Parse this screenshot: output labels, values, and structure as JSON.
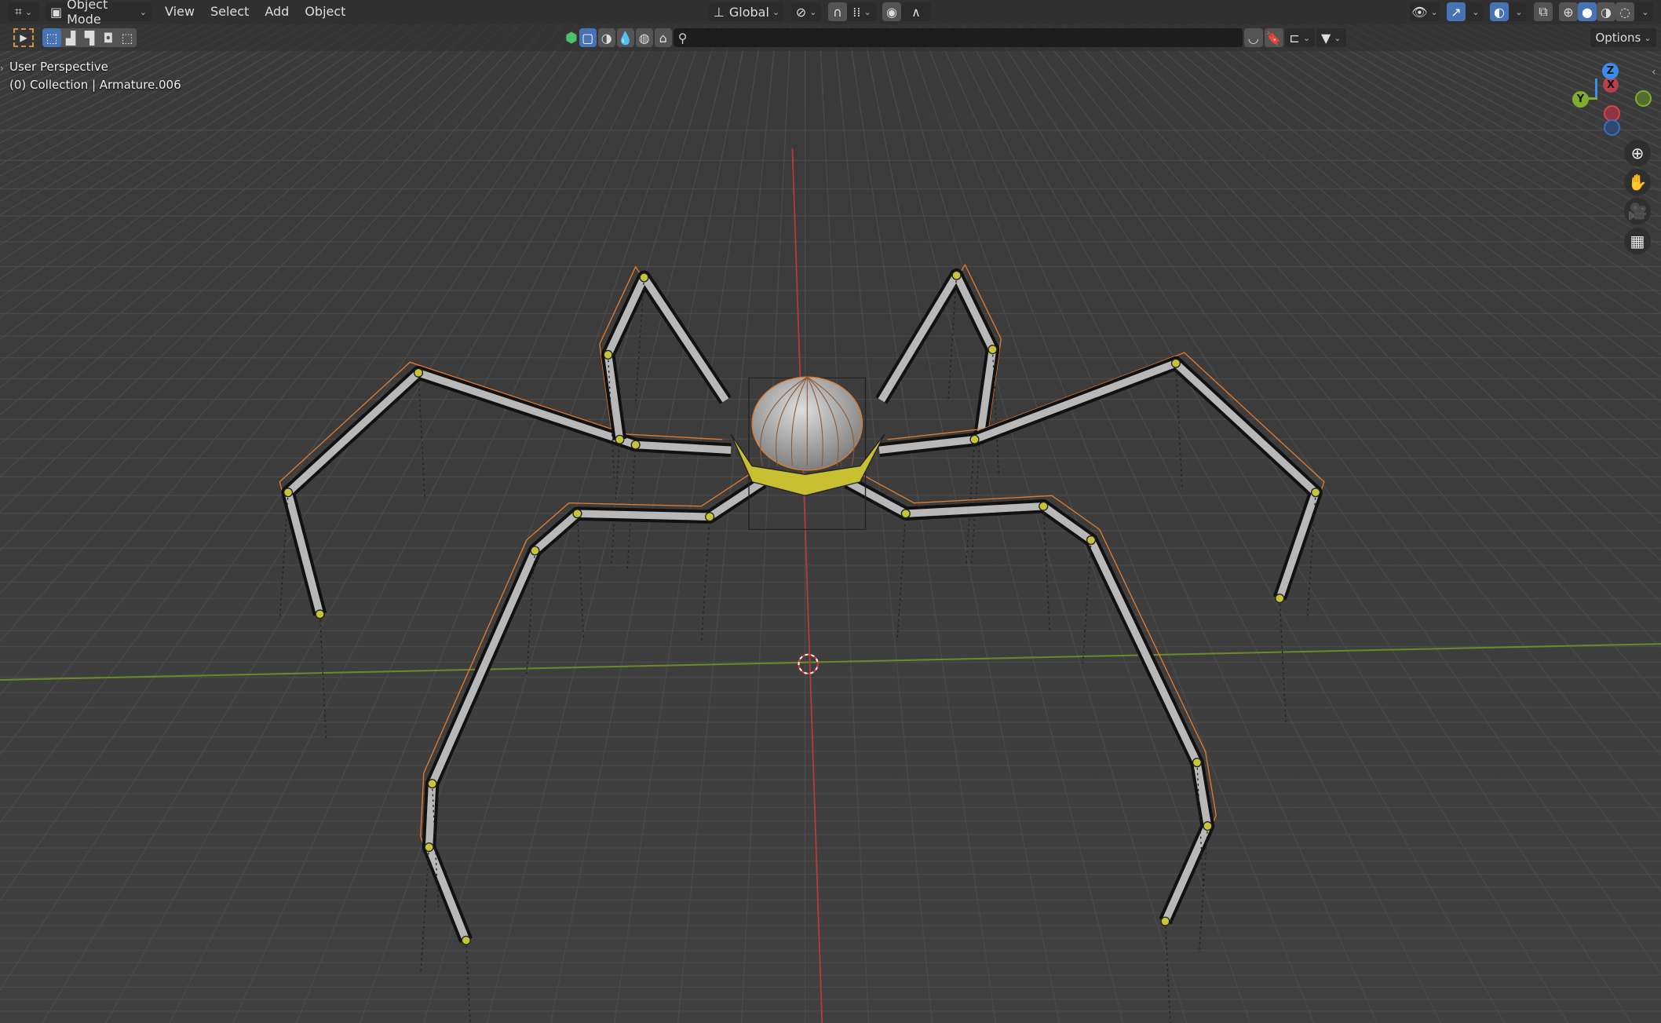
{
  "header": {
    "mode": "Object Mode",
    "menus": [
      "View",
      "Select",
      "Add",
      "Object"
    ],
    "transform_orientation": "Global",
    "options": "Options",
    "search_placeholder": ""
  },
  "overlay": {
    "view_name": "User Perspective",
    "collection": "(0) Collection | Armature.006"
  },
  "gizmo": {
    "z": "Z",
    "y": "Y",
    "x": "X"
  },
  "colors": {
    "accent": "#4772b3",
    "x_axis": "#d9424f",
    "y_axis": "#7fad2c",
    "z_axis": "#3a8ded",
    "bone_outline": "#e07a2c"
  }
}
